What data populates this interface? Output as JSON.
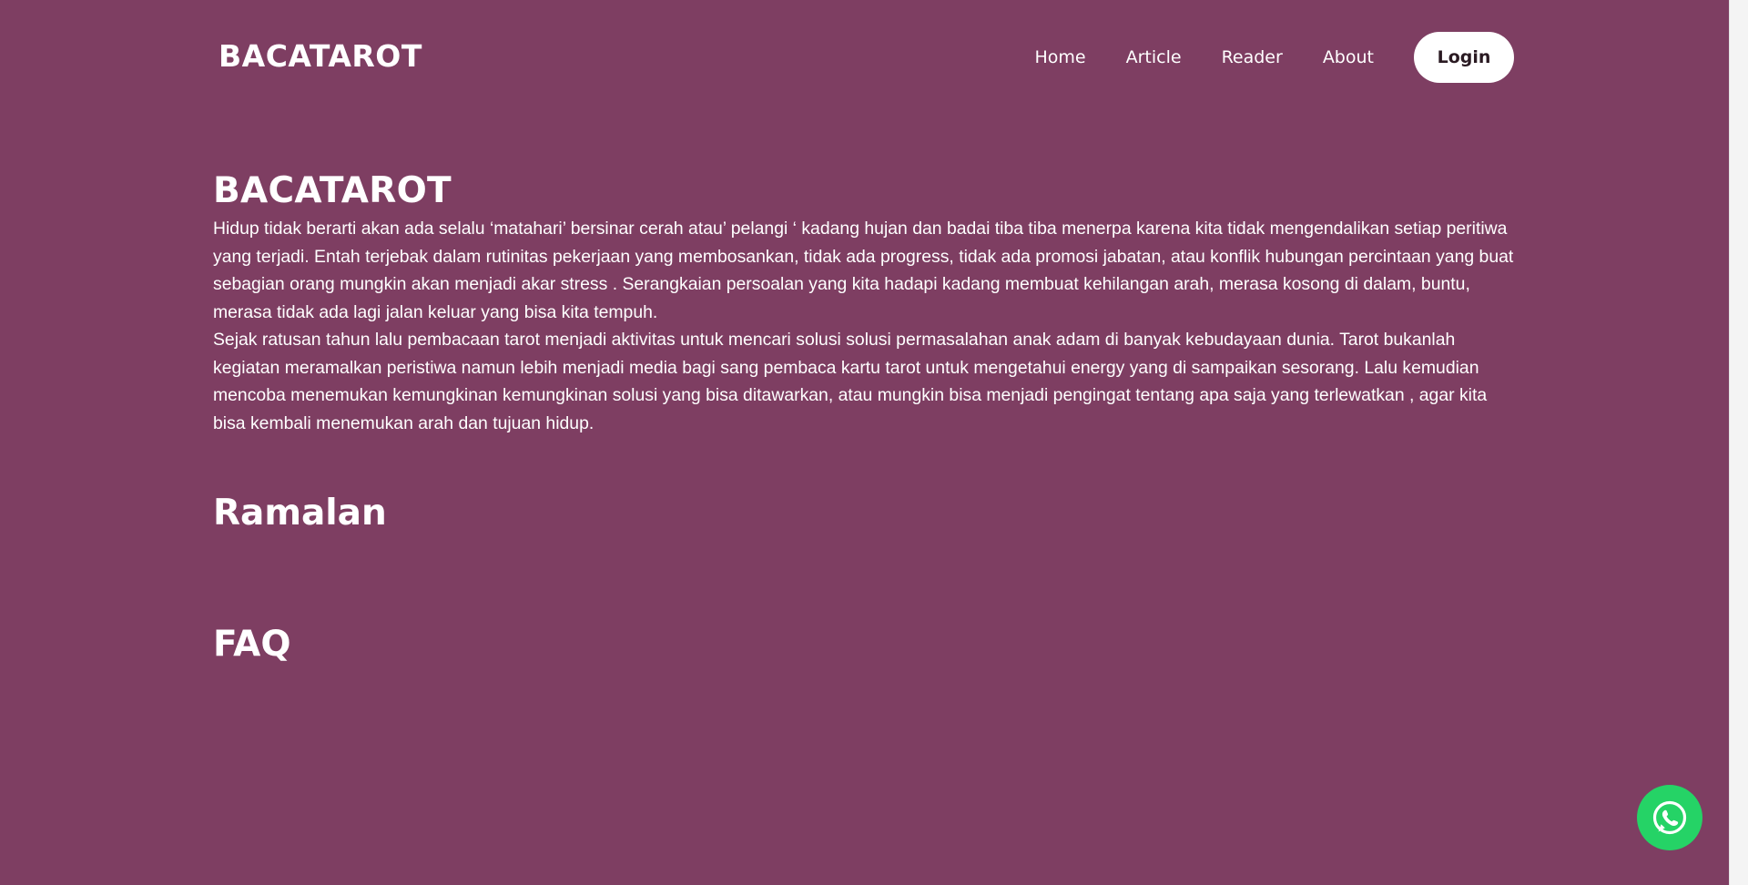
{
  "navbar": {
    "brand": "BACATAROT",
    "links": [
      "Home",
      "Article",
      "Reader",
      "About"
    ],
    "login_label": "Login"
  },
  "hero": {
    "title": "BACATAROT",
    "paragraphs": [
      "Hidup tidak berarti akan ada selalu ‘matahari’ bersinar cerah atau’ pelangi ‘ kadang hujan dan badai tiba tiba menerpa karena kita tidak mengendalikan setiap peritiwa yang terjadi. Entah terjebak dalam rutinitas pekerjaan yang membosankan, tidak ada progress, tidak ada promosi jabatan, atau konflik hubungan percintaan yang buat sebagian orang mungkin akan menjadi akar stress . Serangkaian persoalan yang kita hadapi kadang membuat kehilangan arah, merasa kosong di dalam, buntu, merasa tidak ada lagi jalan keluar yang bisa kita tempuh.",
      "Sejak ratusan tahun lalu pembacaan tarot menjadi aktivitas untuk mencari solusi solusi permasalahan anak adam di banyak kebudayaan dunia. Tarot bukanlah kegiatan meramalkan peristiwa namun lebih menjadi media bagi sang pembaca kartu tarot untuk mengetahui energy yang di sampaikan sesorang. Lalu kemudian mencoba menemukan kemungkinan kemungkinan solusi yang bisa ditawarkan, atau mungkin bisa menjadi pengingat tentang apa saja yang terlewatkan , agar kita bisa kembali menemukan arah dan tujuan hidup."
    ]
  },
  "sections": {
    "ramalan_title": "Ramalan",
    "faq_title": "FAQ"
  },
  "floating": {
    "icon": "whatsapp-icon"
  },
  "colors": {
    "background": "#7e3e62",
    "text": "#ffffff",
    "login_bg": "#ffffff",
    "login_text": "#2a1a22",
    "whatsapp": "#25d366"
  }
}
